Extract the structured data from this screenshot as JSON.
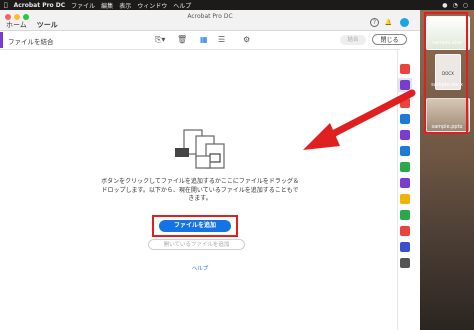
{
  "menubar": {
    "app_name": "Acrobat Pro DC",
    "items": [
      "ファイル",
      "編集",
      "表示",
      "ウィンドウ",
      "ヘルプ"
    ]
  },
  "window": {
    "title": "Acrobat Pro DC",
    "tabs": [
      {
        "label": "ホーム",
        "active": false
      },
      {
        "label": "ツール",
        "active": true
      }
    ]
  },
  "toolbar": {
    "title": "ファイルを結合",
    "combine_label": "結合",
    "close_label": "閉じる"
  },
  "main": {
    "instruction": "ボタンをクリックしてファイルを追加するかここにファイルをドラッグ＆ドロップします。以下から、現在開いているファイルを追加することもできます。",
    "add_files_label": "ファイルを追加",
    "add_open_files_label": "開いているファイルを追加",
    "help_label": "ヘルプ"
  },
  "desktop": {
    "items": [
      {
        "label": "sample.xlsx"
      },
      {
        "label": "sample.docx",
        "icon_text": "DOCX"
      },
      {
        "label": "sample.pptx"
      }
    ]
  },
  "colors": {
    "accent": "#1473e6",
    "highlight": "#e02020",
    "tool_bar": "#7a3bd1"
  }
}
